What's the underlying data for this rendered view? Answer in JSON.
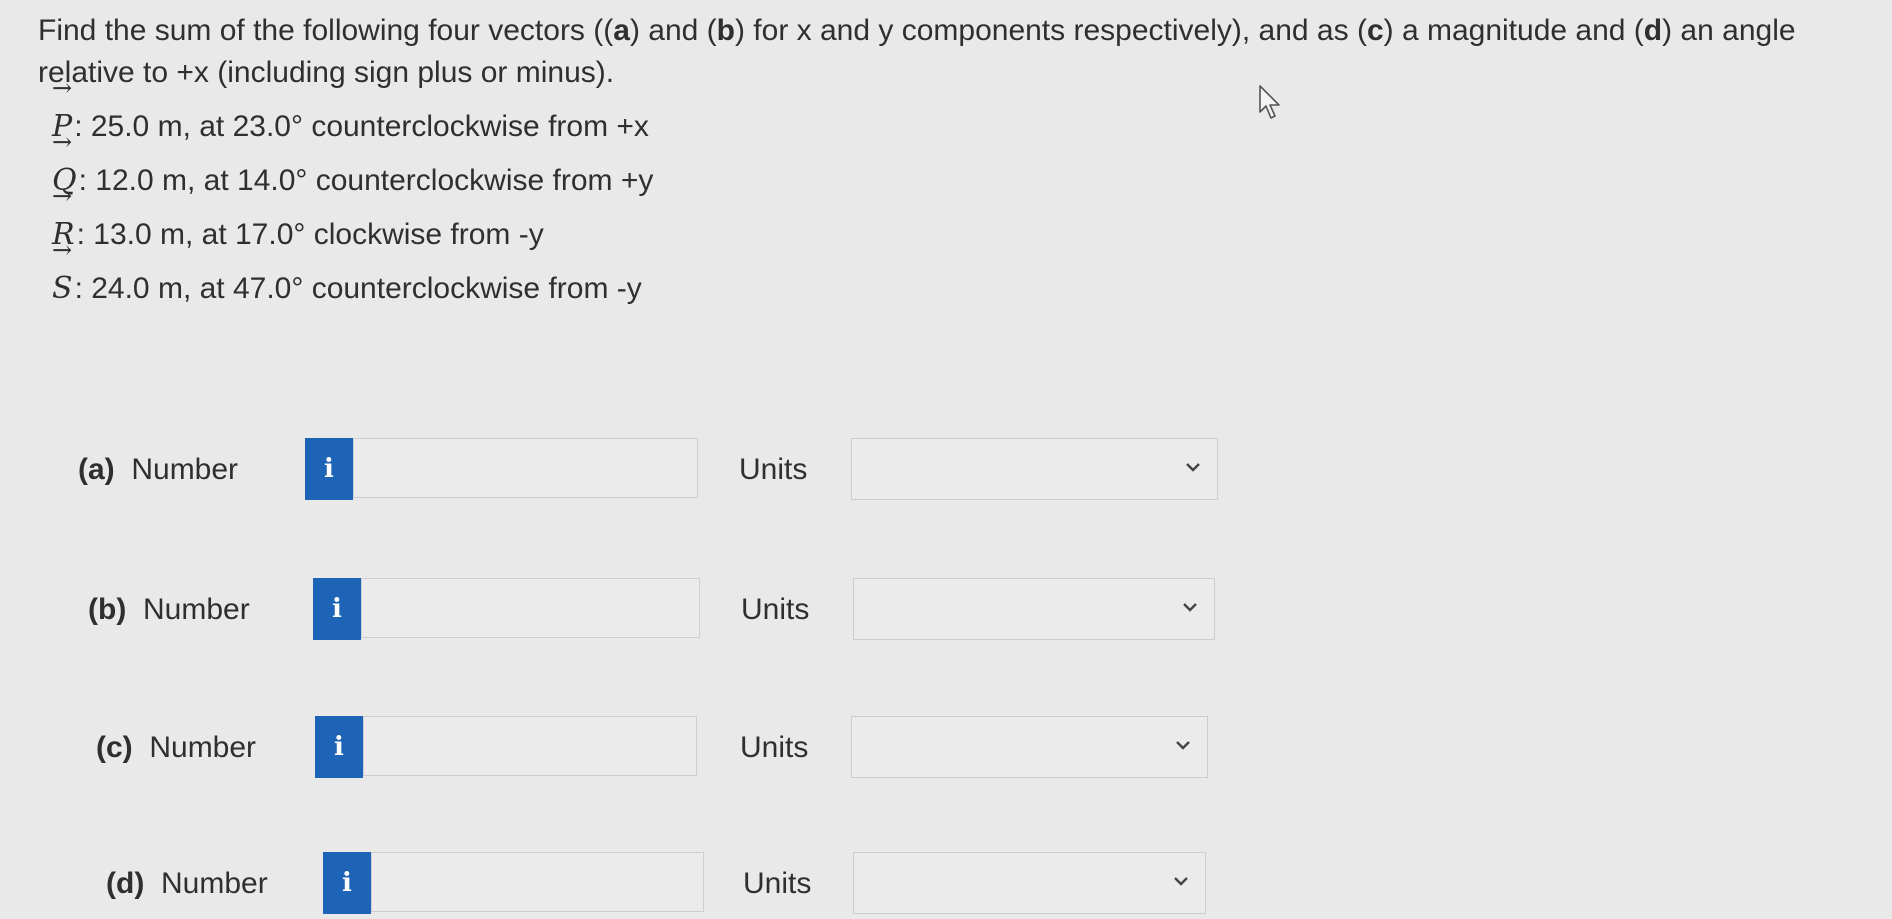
{
  "question": {
    "line1_a": "Find the sum of the following four vectors ((",
    "a": "a",
    "line1_b": ") and (",
    "b": "b",
    "line1_c": ") for x and y components respectively), and as (",
    "c": "c",
    "line1_d": ") a magnitude and (",
    "d": "d",
    "line1_e": ") an angle",
    "line2": "relative to +x (including sign plus or minus)."
  },
  "vectors": [
    {
      "symbol": "P",
      "arrow": "→",
      "text": ": 25.0 m, at 23.0° counterclockwise from +x"
    },
    {
      "symbol": "Q",
      "arrow": "→",
      "text": ": 12.0 m, at 14.0° counterclockwise from +y"
    },
    {
      "symbol": "R",
      "arrow": "→",
      "text": ": 13.0 m, at 17.0° clockwise from -y"
    },
    {
      "symbol": "S",
      "arrow": "→",
      "text": ": 24.0 m, at 47.0° counterclockwise from -y"
    }
  ],
  "parts": [
    {
      "label": "(a)",
      "number_label": "Number",
      "info": "i",
      "value": "",
      "units_label": "Units",
      "units_value": ""
    },
    {
      "label": "(b)",
      "number_label": "Number",
      "info": "i",
      "value": "",
      "units_label": "Units",
      "units_value": ""
    },
    {
      "label": "(c)",
      "number_label": "Number",
      "info": "i",
      "value": "",
      "units_label": "Units",
      "units_value": ""
    },
    {
      "label": "(d)",
      "number_label": "Number",
      "info": "i",
      "value": "",
      "units_label": "Units",
      "units_value": ""
    }
  ],
  "colors": {
    "background": "#e9e9e9",
    "info_button": "#1d64b6",
    "text": "#2f2f2f"
  },
  "icons": {
    "info": "info-icon",
    "dropdown": "chevron-down-icon",
    "cursor": "mouse-cursor-icon"
  }
}
